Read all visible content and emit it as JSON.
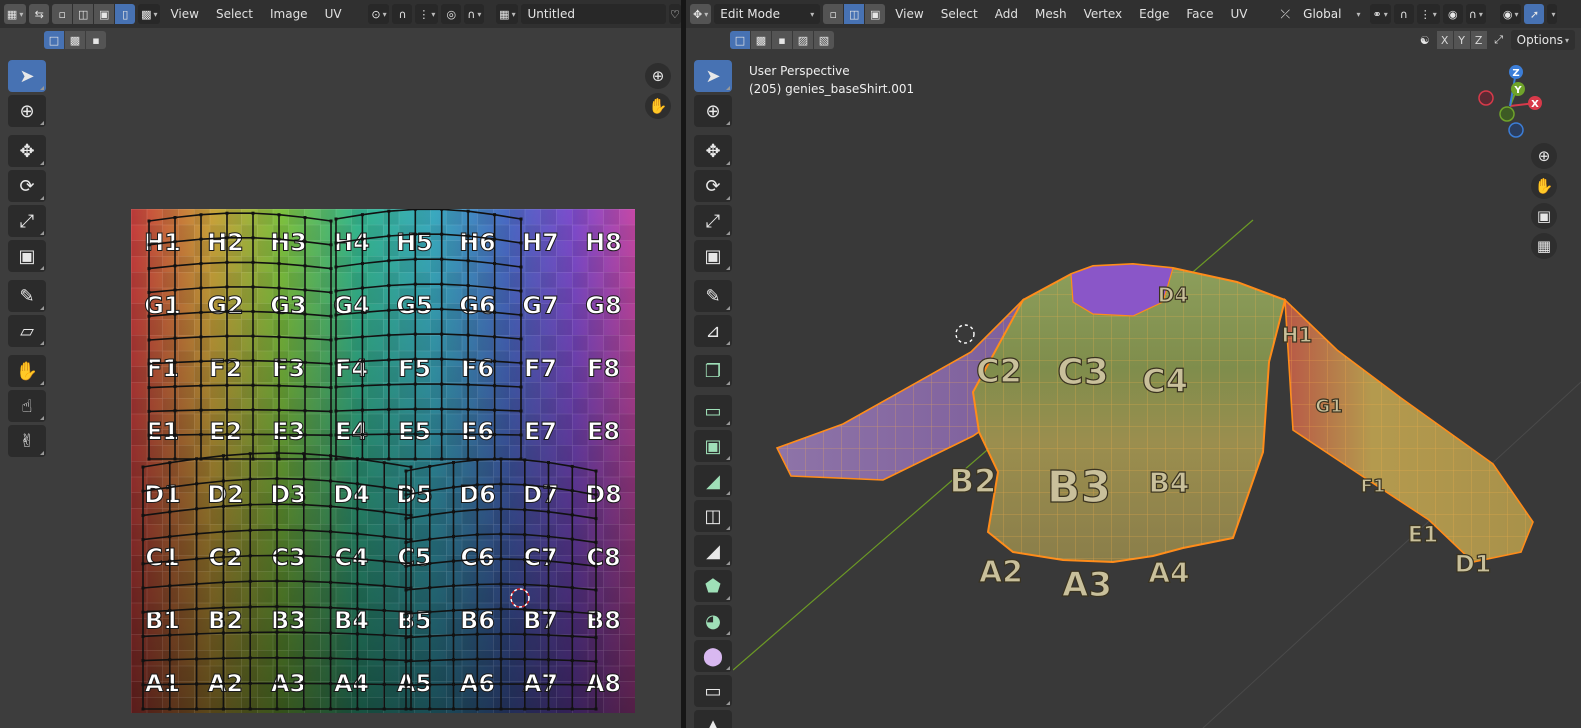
{
  "uv_editor": {
    "menus": [
      "View",
      "Select",
      "Image",
      "UV"
    ],
    "image_name": "Untitled",
    "grid_cols": [
      "1",
      "2",
      "3",
      "4",
      "5",
      "6",
      "7",
      "8"
    ],
    "grid_rows": [
      "H",
      "G",
      "F",
      "E",
      "D",
      "C",
      "B",
      "A"
    ],
    "icons": {
      "editor_type": "uv-editor-icon",
      "sync": "uv-sync-icon",
      "vertex_mode": "vertex-select-icon",
      "edge_mode": "edge-select-icon",
      "face_mode": "face-select-icon",
      "island_mode": "island-select-icon",
      "pivot": "pivot-point-icon",
      "snap": "snap-magnet-icon",
      "proportional": "proportional-edit-icon",
      "falloff": "falloff-curve-icon",
      "image_browse": "image-browse-icon",
      "zoom": "zoom-icon",
      "pan": "pan-hand-icon"
    },
    "tools": [
      "select-box-icon",
      "cursor-icon",
      "move-icon",
      "rotate-icon",
      "scale-icon",
      "transform-icon",
      "annotate-icon",
      "rip-icon",
      "grab-icon",
      "relax-icon",
      "pinch-icon"
    ]
  },
  "viewport": {
    "mode": "Edit Mode",
    "menus": [
      "View",
      "Select",
      "Add",
      "Mesh",
      "Vertex",
      "Edge",
      "Face",
      "UV"
    ],
    "orientation": "Global",
    "perspective_label": "User Perspective",
    "object_label": "(205) genies_baseShirt.001",
    "axes": [
      "X",
      "Y",
      "Z"
    ],
    "options_label": "Options",
    "gizmo": {
      "x": "X",
      "y": "Y",
      "z": "Z"
    },
    "tools": [
      "select-box-icon",
      "cursor-icon",
      "move-icon",
      "rotate-icon",
      "scale-icon",
      "transform-icon",
      "annotate-icon",
      "measure-icon",
      "add-cube-icon",
      "extrude-icon",
      "inset-icon",
      "bevel-icon",
      "loop-cut-icon",
      "knife-icon",
      "poly-build-icon",
      "spin-icon",
      "smooth-icon",
      "edge-slide-icon",
      "shrink-icon"
    ],
    "shirt_labels": [
      "D4",
      "C2",
      "C3",
      "C4",
      "B2",
      "B3",
      "B4",
      "A2",
      "A3",
      "A4",
      "H1",
      "G1",
      "F1",
      "E1",
      "D1"
    ],
    "colors": {
      "wire": "#ff8c1a",
      "accent": "#4772b3",
      "grid_line_x": "#8b3434",
      "grid_line_y": "#6c9a25"
    }
  }
}
